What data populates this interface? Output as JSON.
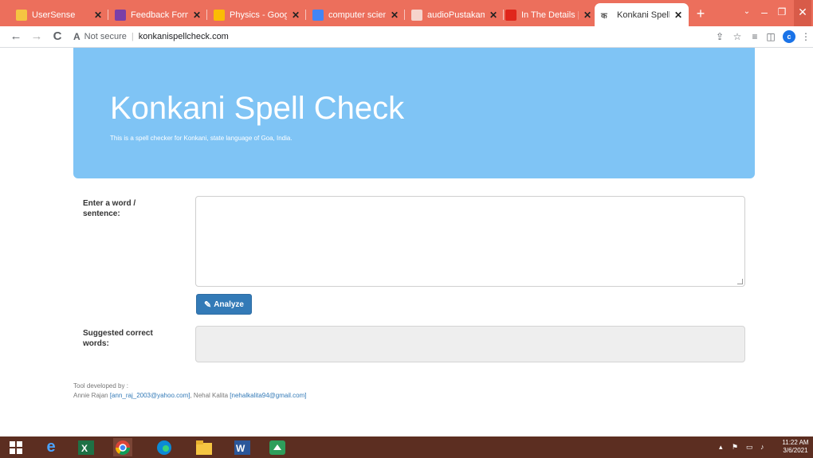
{
  "browser": {
    "tabs": [
      {
        "title": "UserSense",
        "favicon_color": "#f5c542"
      },
      {
        "title": "Feedback Form Li",
        "favicon_color": "#7a3fa8"
      },
      {
        "title": "Physics - Google",
        "favicon_color": "#fbbc04"
      },
      {
        "title": "computer science",
        "favicon_color": "#4285f4"
      },
      {
        "title": "audioPustakam |",
        "favicon_color": "#f6d4cc"
      },
      {
        "title": "In The Details | Ta",
        "favicon_color": "#e0261b"
      },
      {
        "title": "Konkani Spell Che",
        "favicon_color": "#555555"
      }
    ],
    "new_tab_symbol": "+",
    "nav": {
      "back": "←",
      "forward": "→",
      "reload": "C"
    },
    "address": {
      "security_icon": "A",
      "security_text": "Not secure",
      "url": "konkanispellcheck.com"
    },
    "profile_initial": "c"
  },
  "page": {
    "title": "Konkani Spell Check",
    "subtitle": "This is a spell checker for Konkani, state language of Goa, India.",
    "input_label": "Enter a word / sentence:",
    "input_value": "",
    "analyze_button": "Analyze",
    "suggestions_label": "Suggested correct words:",
    "suggestions_value": "",
    "footer": {
      "line1": "Tool developed by :",
      "author1": "Annie Rajan",
      "email1": "[ann_raj_2003@yahoo.com]",
      "separator": ", ",
      "author2": "Nehal Kalita",
      "email2": "[nehalkalita94@gmail.com]"
    }
  },
  "taskbar": {
    "time": "11:22 AM",
    "date": "3/6/2021"
  },
  "colors": {
    "tabbar": "#ec6f5c",
    "jumbotron": "#7fc4f5",
    "button": "#337ab7",
    "taskbar": "#5c2e21"
  }
}
